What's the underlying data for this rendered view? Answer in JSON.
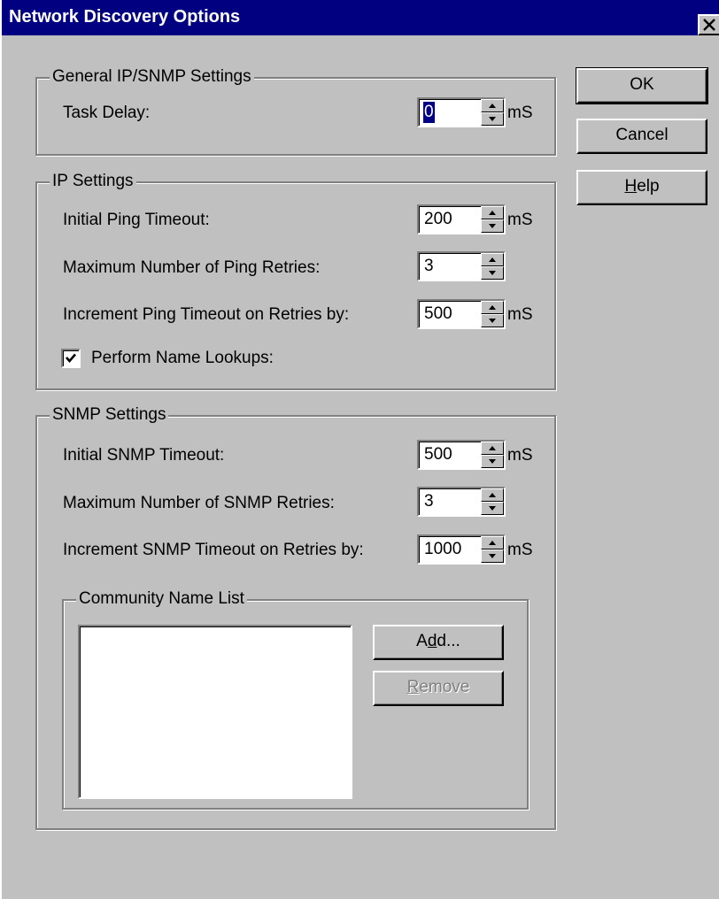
{
  "window": {
    "title": "Network Discovery Options"
  },
  "buttons": {
    "ok": "OK",
    "cancel": "Cancel",
    "help_mnemonic": "H",
    "help_rest": "elp"
  },
  "general": {
    "legend": "General IP/SNMP Settings",
    "task_delay_label": "Task Delay:",
    "task_delay_value": "0",
    "task_delay_unit": "mS"
  },
  "ip": {
    "legend": "IP Settings",
    "initial_ping_timeout_label": "Initial Ping Timeout:",
    "initial_ping_timeout_value": "200",
    "initial_ping_timeout_unit": "mS",
    "max_ping_retries_label": "Maximum Number of Ping Retries:",
    "max_ping_retries_value": "3",
    "increment_ping_label": "Increment Ping Timeout on Retries by:",
    "increment_ping_value": "500",
    "increment_ping_unit": "mS",
    "name_lookups_label": "Perform Name Lookups:",
    "name_lookups_checked": true
  },
  "snmp": {
    "legend": "SNMP Settings",
    "initial_snmp_timeout_label": "Initial SNMP Timeout:",
    "initial_snmp_timeout_value": "500",
    "initial_snmp_timeout_unit": "mS",
    "max_snmp_retries_label": "Maximum Number of SNMP Retries:",
    "max_snmp_retries_value": "3",
    "increment_snmp_label": "Increment SNMP Timeout on Retries by:",
    "increment_snmp_value": "1000",
    "increment_snmp_unit": "mS"
  },
  "community": {
    "legend": "Community Name List",
    "items": [],
    "add_pre": "A",
    "add_mnemonic": "d",
    "add_post": "d...",
    "remove_mnemonic": "R",
    "remove_rest": "emove"
  },
  "icons": {
    "close": "close-icon",
    "spin_up": "arrow-up-icon",
    "spin_down": "arrow-down-icon",
    "check": "checkmark-icon"
  },
  "colors": {
    "face": "#c0c0c0",
    "titlebar": "#000080",
    "highlight": "#ffffff",
    "shadow": "#808080"
  }
}
